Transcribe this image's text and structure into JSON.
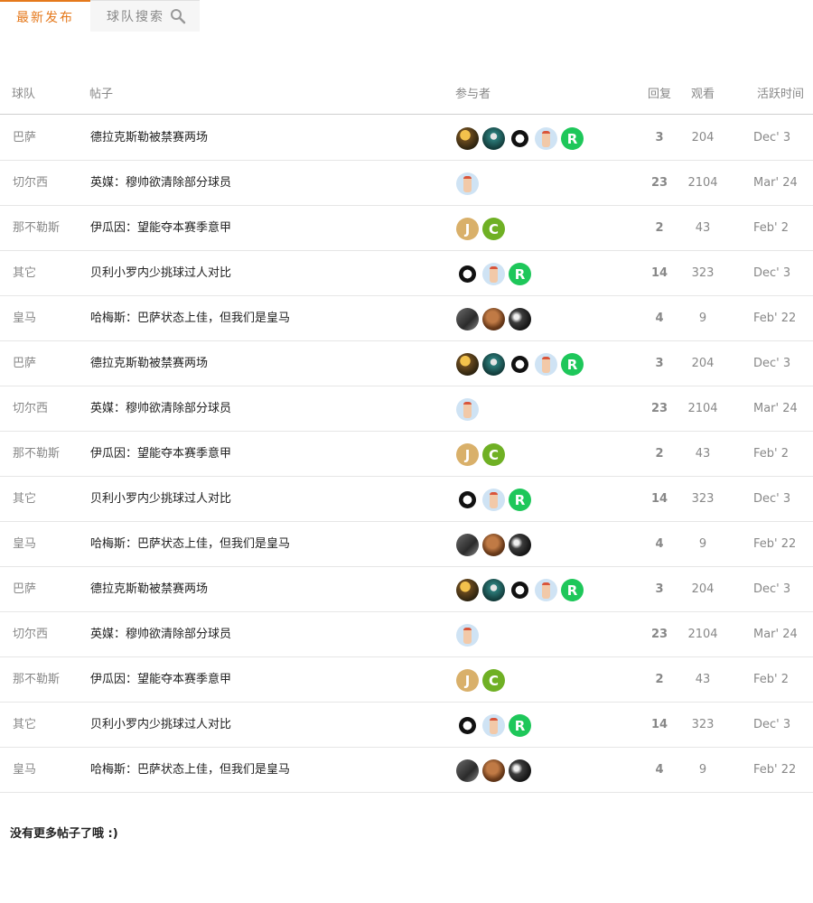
{
  "tabs": {
    "latest_label": "最新发布",
    "search_label": "球队搜索"
  },
  "table": {
    "headers": {
      "team": "球队",
      "post": "帖子",
      "participants": "参与者",
      "replies": "回复",
      "views": "观看",
      "active_time": "活跃时间"
    },
    "rows": [
      {
        "team": "巴萨",
        "title": "德拉克斯勒被禁赛两场",
        "replies": "3",
        "views": "204",
        "time": "Dec' 3",
        "avatars": [
          "photo1",
          "photo2",
          "mane",
          "face",
          "R"
        ]
      },
      {
        "team": "切尔西",
        "title": "英媒：穆帅欲清除部分球员",
        "replies": "23",
        "views": "2104",
        "time": "Mar' 24",
        "avatars": [
          "face"
        ]
      },
      {
        "team": "那不勒斯",
        "title": "伊瓜因：望能夺本赛季意甲",
        "replies": "2",
        "views": "43",
        "time": "Feb' 2",
        "avatars": [
          "J",
          "C"
        ]
      },
      {
        "team": "其它",
        "title": "贝利小罗内少挑球过人对比",
        "replies": "14",
        "views": "323",
        "time": "Dec' 3",
        "avatars": [
          "mane",
          "face",
          "R"
        ]
      },
      {
        "team": "皇马",
        "title": "哈梅斯：巴萨状态上佳，但我们是皇马",
        "replies": "4",
        "views": "9",
        "time": "Feb' 22",
        "avatars": [
          "photo3",
          "photo4",
          "photo5"
        ]
      },
      {
        "team": "巴萨",
        "title": "德拉克斯勒被禁赛两场",
        "replies": "3",
        "views": "204",
        "time": "Dec' 3",
        "avatars": [
          "photo1",
          "photo2",
          "mane",
          "face",
          "R"
        ]
      },
      {
        "team": "切尔西",
        "title": "英媒：穆帅欲清除部分球员",
        "replies": "23",
        "views": "2104",
        "time": "Mar' 24",
        "avatars": [
          "face"
        ]
      },
      {
        "team": "那不勒斯",
        "title": "伊瓜因：望能夺本赛季意甲",
        "replies": "2",
        "views": "43",
        "time": "Feb' 2",
        "avatars": [
          "J",
          "C"
        ]
      },
      {
        "team": "其它",
        "title": "贝利小罗内少挑球过人对比",
        "replies": "14",
        "views": "323",
        "time": "Dec' 3",
        "avatars": [
          "mane",
          "face",
          "R"
        ]
      },
      {
        "team": "皇马",
        "title": "哈梅斯：巴萨状态上佳，但我们是皇马",
        "replies": "4",
        "views": "9",
        "time": "Feb' 22",
        "avatars": [
          "photo3",
          "photo4",
          "photo5"
        ]
      },
      {
        "team": "巴萨",
        "title": "德拉克斯勒被禁赛两场",
        "replies": "3",
        "views": "204",
        "time": "Dec' 3",
        "avatars": [
          "photo1",
          "photo2",
          "mane",
          "face",
          "R"
        ]
      },
      {
        "team": "切尔西",
        "title": "英媒：穆帅欲清除部分球员",
        "replies": "23",
        "views": "2104",
        "time": "Mar' 24",
        "avatars": [
          "face"
        ]
      },
      {
        "team": "那不勒斯",
        "title": "伊瓜因：望能夺本赛季意甲",
        "replies": "2",
        "views": "43",
        "time": "Feb' 2",
        "avatars": [
          "J",
          "C"
        ]
      },
      {
        "team": "其它",
        "title": "贝利小罗内少挑球过人对比",
        "replies": "14",
        "views": "323",
        "time": "Dec' 3",
        "avatars": [
          "mane",
          "face",
          "R"
        ]
      },
      {
        "team": "皇马",
        "title": "哈梅斯：巴萨状态上佳，但我们是皇马",
        "replies": "4",
        "views": "9",
        "time": "Feb' 22",
        "avatars": [
          "photo3",
          "photo4",
          "photo5"
        ]
      }
    ]
  },
  "avatar_colors": {
    "R": "#1ec75a",
    "J": "#d9b06a",
    "C": "#6fb024"
  },
  "footer": {
    "text": "没有更多帖子了哦 :)"
  },
  "colors": {
    "accent": "#e5791c",
    "muted_text": "#888888",
    "body_text": "#222222"
  }
}
